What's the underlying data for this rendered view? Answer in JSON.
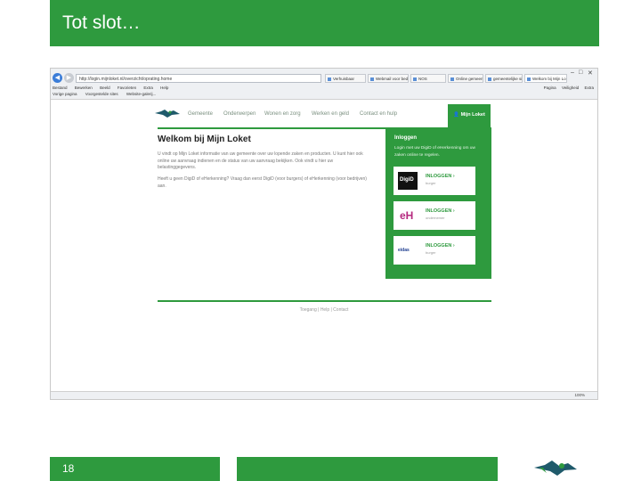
{
  "slide": {
    "title": "Tot slot…",
    "page_number": "18"
  },
  "browser": {
    "address": "http://login.mijnloket.nl/overzicht/oprating.home",
    "tabs": [
      "Verhuisbaar",
      "Webmail voor bedrijven",
      "NOS",
      "Online gemeente ...",
      "gemeentelijke site...",
      "Welkom bij Mijn Lo..."
    ],
    "menu": [
      "Bestand",
      "Bewerken",
      "Beeld",
      "Favorieten",
      "Extra",
      "Help"
    ],
    "favorites": [
      "Vorige pagina",
      "Voorgestelde sites",
      "Website-galerij..."
    ],
    "right_tools": [
      "Pagina",
      "Veiligheid",
      "Extra"
    ],
    "zoom": "100%"
  },
  "site": {
    "nav": [
      "Gemeente",
      "Onderwerpen",
      "Wonen en zorg",
      "Werken en geld",
      "Contact en hulp"
    ],
    "login_nav": "Mijn Loket",
    "welcome": "Welkom bij Mijn Loket",
    "intro": "U vindt op Mijn Loket informatie van uw gemeente over uw lopende zaken en producten. U kunt hier ook online uw aanvraag indienen en de status van uw aanvraag bekijken. Ook vindt u hier uw belastinggegevens.",
    "intro2": "Heeft u geen DigiD of eHerkenning? Vraag dan eerst DigiD (voor burgers) of eHerkenning (voor bedrijven) aan.",
    "panel_title": "Inloggen",
    "panel_text": "Login met uw DigiD of eHerkenning om uw zaken online te regelen.",
    "cards": [
      {
        "cta": "INLOGGEN ›",
        "sub": "burger",
        "logo": "DigiD"
      },
      {
        "cta": "INLOGGEN ›",
        "sub": "ondernemer",
        "logo": "eH"
      },
      {
        "cta": "INLOGGEN ›",
        "sub": "burger",
        "logo": "eidas"
      }
    ],
    "footer": "Toegang  |  Help  |  Contact"
  },
  "colors": {
    "brand_green": "#2e9a3e",
    "browser_chrome": "#eef0f3",
    "link_blue": "#3b7dd8"
  }
}
